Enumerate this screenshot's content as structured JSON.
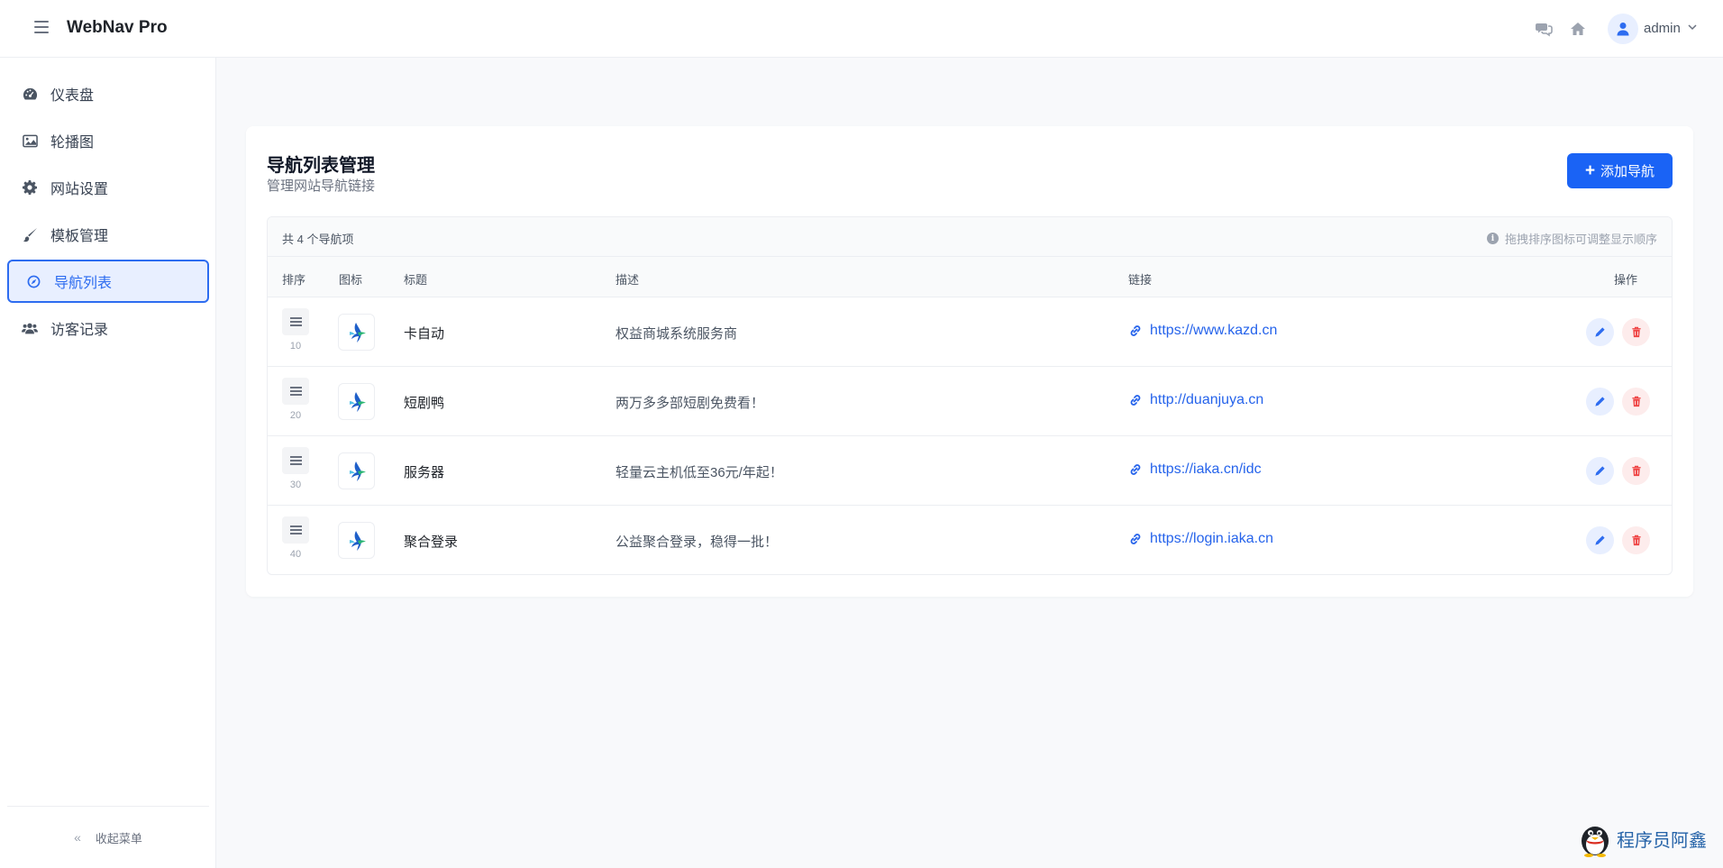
{
  "header": {
    "brand": "WebNav Pro",
    "username": "admin"
  },
  "sidebar": {
    "items": [
      {
        "label": "仪表盘",
        "icon": "dashboard-icon"
      },
      {
        "label": "轮播图",
        "icon": "image-icon"
      },
      {
        "label": "网站设置",
        "icon": "gear-icon"
      },
      {
        "label": "模板管理",
        "icon": "brush-icon"
      },
      {
        "label": "导航列表",
        "icon": "compass-icon",
        "active": true
      },
      {
        "label": "访客记录",
        "icon": "users-icon"
      }
    ],
    "collapse_label": "收起菜单"
  },
  "card": {
    "title": "导航列表管理",
    "subtitle": "管理网站导航链接",
    "add_label": "添加导航",
    "count_text": "共 4 个导航项",
    "hint_text": "拖拽排序图标可调整显示顺序",
    "columns": {
      "sort": "排序",
      "icon": "图标",
      "title": "标题",
      "desc": "描述",
      "link": "链接",
      "ops": "操作"
    },
    "rows": [
      {
        "sort": "10",
        "title": "卡自动",
        "desc": "权益商城系统服务商",
        "link": "https://www.kazd.cn"
      },
      {
        "sort": "20",
        "title": "短剧鸭",
        "desc": "两万多多部短剧免费看！",
        "link": "http://duanjuya.cn"
      },
      {
        "sort": "30",
        "title": "服务器",
        "desc": "轻量云主机低至36元/年起！",
        "link": "https://iaka.cn/idc"
      },
      {
        "sort": "40",
        "title": "聚合登录",
        "desc": "公益聚合登录，稳得一批！",
        "link": "https://login.iaka.cn"
      }
    ]
  },
  "watermark": {
    "text": "程序员阿鑫"
  },
  "colors": {
    "accent": "#1a63f5",
    "link": "#2563eb",
    "danger": "#ef4444"
  }
}
